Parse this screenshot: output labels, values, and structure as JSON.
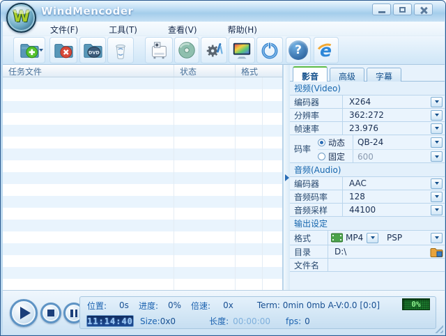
{
  "window": {
    "title": "WindMencoder",
    "logo_letter": "W"
  },
  "menu": {
    "items": [
      {
        "label": "文件(F)"
      },
      {
        "label": "工具(T)"
      },
      {
        "label": "查看(V)"
      },
      {
        "label": "帮助(H)"
      }
    ]
  },
  "toolbar": {
    "buttons": [
      "add-task",
      "remove-task",
      "add-dvd",
      "clear-tasks",
      "start-encode",
      "burn-disc",
      "settings",
      "preview",
      "power",
      "help",
      "website"
    ],
    "dvd_label": "DVD",
    "help_glyph": "?",
    "ie_glyph": "e"
  },
  "table": {
    "columns": [
      {
        "label": "任务文件"
      },
      {
        "label": "状态"
      },
      {
        "label": "格式"
      }
    ],
    "rows": []
  },
  "panel": {
    "tabs": [
      {
        "label": "影音",
        "active": true
      },
      {
        "label": "高级",
        "active": false
      },
      {
        "label": "字幕",
        "active": false
      }
    ],
    "video": {
      "title": "视频(Video)",
      "fields": [
        {
          "label": "编码器",
          "value": "X264"
        },
        {
          "label": "分辨率",
          "value": "362:272"
        },
        {
          "label": "帧速率",
          "value": "23.976"
        }
      ],
      "bitrate": {
        "label": "码率",
        "dynamic": {
          "label": "动态",
          "value": "QB-24",
          "selected": true
        },
        "fixed": {
          "label": "固定",
          "value": "600",
          "selected": false
        }
      }
    },
    "audio": {
      "title": "音频(Audio)",
      "fields": [
        {
          "label": "编码器",
          "value": "AAC"
        },
        {
          "label": "音频码率",
          "value": "128"
        },
        {
          "label": "音频采样",
          "value": "44100"
        }
      ]
    },
    "output": {
      "title": "输出设定",
      "format": {
        "label": "格式",
        "container": "MP4",
        "preset": "PSP"
      },
      "dir": {
        "label": "目录",
        "value": "D:\\"
      },
      "filename": {
        "label": "文件名",
        "value": ""
      }
    }
  },
  "status": {
    "row1": {
      "position_label": "位置:",
      "position_value": "0s",
      "progress_label": "进度:",
      "progress_value": "0%",
      "speed_label": "倍速:",
      "speed_value": "0x",
      "term": "Term: 0min 0mb A-V:0.0 [0:0]"
    },
    "row2": {
      "timer": "11:14:40",
      "size_label": "Size:",
      "size_value": "0x0",
      "length_label": "长度:",
      "length_value": "00:00:00",
      "fps_label": "fps:",
      "fps_value": "0",
      "encode_progress": "0%"
    }
  },
  "colors": {
    "accent_blue": "#2a6db6",
    "panel_blue": "#e7f2fc",
    "progress_green": "#114d1d",
    "lcd_navy": "#1d4a94",
    "tab_active_green": "#5dbb46"
  }
}
